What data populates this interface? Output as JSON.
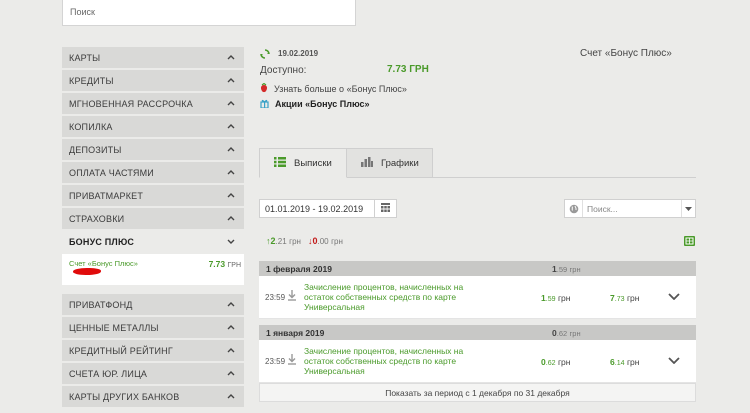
{
  "search": {
    "placeholder": "Поиск"
  },
  "sidebar": {
    "items_top": [
      {
        "label": "КАРТЫ"
      },
      {
        "label": "КРЕДИТЫ"
      },
      {
        "label": "МГНОВЕННАЯ РАССРОЧКА"
      },
      {
        "label": "КОПИЛКА"
      },
      {
        "label": "ДЕПОЗИТЫ"
      },
      {
        "label": "ОПЛАТА ЧАСТЯМИ"
      },
      {
        "label": "ПРИВАТМАРКЕТ"
      },
      {
        "label": "СТРАХОВКИ"
      },
      {
        "label": "БОНУС ПЛЮС"
      }
    ],
    "sub_account": {
      "name": "Счет «Бонус Плюс»",
      "amount": "7.73",
      "currency": "ГРН"
    },
    "items_bottom": [
      {
        "label": "ПРИВАТФОНД"
      },
      {
        "label": "ЦЕННЫЕ МЕТАЛЛЫ"
      },
      {
        "label": "КРЕДИТНЫЙ РЕЙТИНГ"
      },
      {
        "label": "СЧЕТА ЮР. ЛИЦА"
      },
      {
        "label": "КАРТЫ ДРУГИХ БАНКОВ"
      }
    ]
  },
  "account": {
    "date": "19.02.2019",
    "title": "Счет «Бонус Плюс»",
    "available_label": "Доступно:",
    "available_value": "7.73 ГРН",
    "learn_more": "Узнать больше о «Бонус Плюс»",
    "promos": "Акции «Бонус Плюс»"
  },
  "tabs": {
    "statements": "Выписки",
    "charts": "Графики"
  },
  "filters": {
    "date_range": "01.01.2019 - 19.02.2019",
    "search_placeholder": "Поиск..."
  },
  "totals": {
    "in_int": "2",
    "in_dec": ".21",
    "in_cur": "грн",
    "out_int": "0",
    "out_dec": ".00",
    "out_cur": "грн"
  },
  "groups": [
    {
      "date": "1 февраля 2019",
      "sum_int": "1",
      "sum_dec": ".59",
      "sum_cur": "грн",
      "row": {
        "time": "23:59",
        "desc": "Зачисление процентов, начисленных на остаток собственных средств по карте Универсальная",
        "amt_int": "1",
        "amt_dec": ".59",
        "amt_cur": "грн",
        "bal_int": "7",
        "bal_dec": ".73",
        "bal_cur": "грн"
      }
    },
    {
      "date": "1 января 2019",
      "sum_int": "0",
      "sum_dec": ".62",
      "sum_cur": "грн",
      "row": {
        "time": "23:59",
        "desc": "Зачисление процентов, начисленных на остаток собственных средств по карте Универсальная",
        "amt_int": "0",
        "amt_dec": ".62",
        "amt_cur": "грн",
        "bal_int": "6",
        "bal_dec": ".14",
        "bal_cur": "грн"
      }
    }
  ],
  "show_period": "Показать за период с 1 декабря по 31 декабря",
  "colors": {
    "green": "#4a9a2a",
    "red": "#c21818",
    "sidebar_bg": "#d9d9d7"
  }
}
